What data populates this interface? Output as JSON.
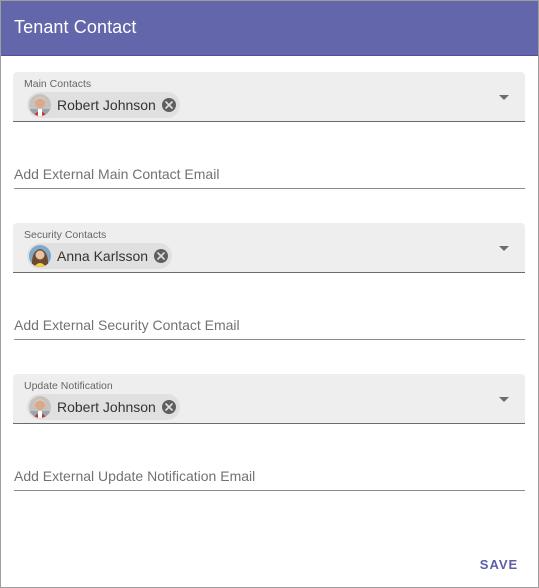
{
  "dialog": {
    "title": "Tenant Contact",
    "header_color": "#6366ab"
  },
  "main_contacts": {
    "label": "Main Contacts",
    "chip_label": "Robert Johnson",
    "avatar": "man-avatar"
  },
  "external_main_contact": {
    "placeholder": "Add External Main Contact Email",
    "value": ""
  },
  "security_contacts": {
    "label": "Security Contacts",
    "chip_label": "Anna Karlsson",
    "avatar": "woman-avatar"
  },
  "external_security_contact": {
    "placeholder": "Add External Security Contact Email",
    "value": ""
  },
  "update_notification": {
    "label": "Update Notification",
    "chip_label": "Robert Johnson",
    "avatar": "man-avatar"
  },
  "external_update_notification": {
    "placeholder": "Add External Update Notification Email",
    "value": ""
  },
  "actions": {
    "save_label": "SAVE",
    "accent_color": "#5c5fa6"
  }
}
